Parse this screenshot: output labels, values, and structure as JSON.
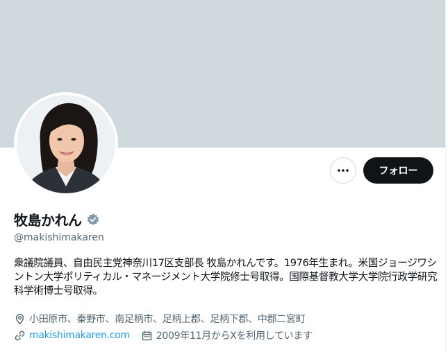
{
  "profile": {
    "name": "牧島かれん",
    "handle": "@makishimakaren",
    "bio": "衆議院議員、自由民主党神奈川17区支部長 牧島かれんです。1976年生まれ。米国ジョージワシントン大学ポリティカル・マネージメント大学院修士号取得。国際基督教大学大学院行政学研究科学術博士号取得。",
    "location": "小田原市、秦野市、南足柄市、足柄上郡、足柄下郡、中郡二宮町",
    "website": "makishimakaren.com",
    "joined": "2009年11月からXを利用しています"
  },
  "actions": {
    "more_label": "···",
    "follow_label": "フォロー"
  },
  "icons": {
    "verified": "verified-badge-icon",
    "location": "location-pin-icon",
    "link": "link-icon",
    "calendar": "calendar-icon",
    "more": "more-dots-icon"
  },
  "colors": {
    "banner": "#cfd9de",
    "link": "#1d9bf0",
    "secondary_text": "#536471",
    "verified_badge": "#829aab",
    "follow_button": "#0f1419"
  }
}
